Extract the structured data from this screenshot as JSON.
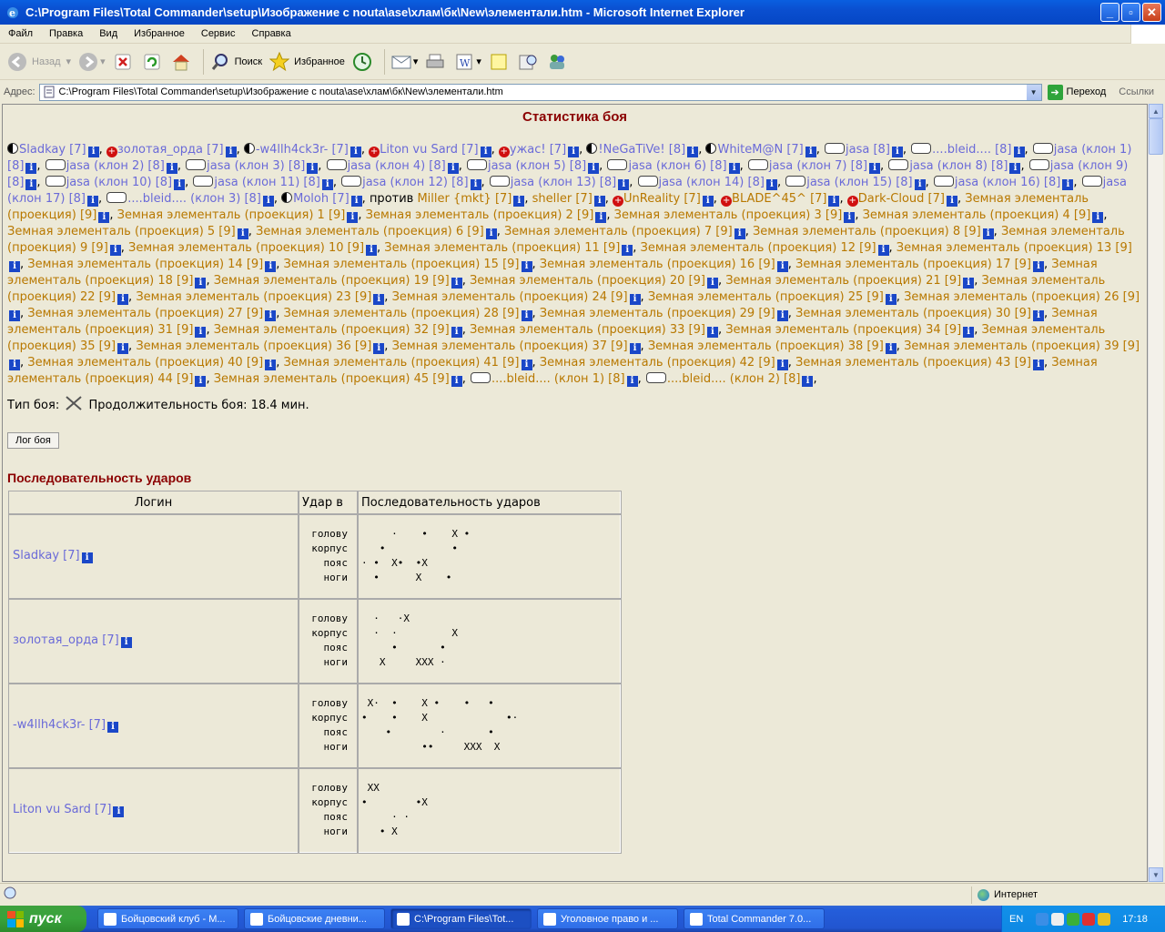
{
  "window": {
    "title": "C:\\Program Files\\Total Commander\\setup\\Изображение с nouta\\ase\\хлам\\бк\\New\\элементали.htm - Microsoft Internet Explorer"
  },
  "menu": [
    "Файл",
    "Правка",
    "Вид",
    "Избранное",
    "Сервис",
    "Справка"
  ],
  "toolbar": {
    "back": "Назад",
    "search": "Поиск",
    "favorites": "Избранное"
  },
  "address": {
    "label": "Адрес:",
    "value": "C:\\Program Files\\Total Commander\\setup\\Изображение с nouta\\ase\\хлам\\бк\\New\\элементали.htm",
    "go": "Переход",
    "links": "Ссылки"
  },
  "page": {
    "heading": "Статистика боя",
    "team1": [
      "Sladkay [7]",
      "золотая_орда [7]",
      "-w4llh4ck3r- [7]",
      "Liton vu Sard [7]",
      "ужас! [7]",
      "!NeGaTiVe! [8]",
      "WhiteM@N [7]",
      "jasa [8]",
      "....bleid.... [8]",
      "jasa (клон 1) [8]",
      "jasa (клон 2) [8]",
      "jasa (клон 3) [8]",
      "jasa (клон 4) [8]",
      "jasa (клон 5) [8]",
      "jasa (клон 6) [8]",
      "jasa (клон 7) [8]",
      "jasa (клон 8) [8]",
      "jasa (клон 9) [8]",
      "jasa (клон 10) [8]",
      "jasa (клон 11) [8]",
      "jasa (клон 12) [8]",
      "jasa (клон 13) [8]",
      "jasa (клон 14) [8]",
      "jasa (клон 15) [8]",
      "jasa (клон 16) [8]",
      "jasa (клон 17) [8]",
      "....bleid.... (клон 3) [8]",
      "Moloh [7]"
    ],
    "versus": "против",
    "team2_a": [
      "Miller {mkt} [7]",
      "sheller [7]",
      "UnReality [7]",
      "BLADE^45^ [7]",
      "Dark-Cloud [7]"
    ],
    "elemental_name": "Земная элементаль (проекция)",
    "elemental_level": "[9]",
    "elemental_count": 46,
    "team2_b": [
      "....bleid.... (клон 1) [8]",
      "....bleid.... (клон 2) [8]"
    ],
    "battle_type_label": "Тип боя:",
    "duration_label": "Продолжительность боя:",
    "duration_value": "18.4 мин.",
    "log_button": "Лог боя",
    "seq_heading": "Последовательность ударов",
    "table_headers": [
      "Логин",
      "Удар в",
      "Последовательность ударов"
    ],
    "zones": [
      "голову",
      "корпус",
      "пояс",
      "ноги"
    ],
    "rows": [
      {
        "login": "Sladkay [7]",
        "hits": [
          "     ·    •    X •",
          "   •           •",
          "· •  X•  •X",
          "  •      X    •"
        ]
      },
      {
        "login": "золотая_орда [7]",
        "hits": [
          "  ·   ·X",
          "  ·  ·         X",
          "     •       •",
          "   X     XXX ·"
        ]
      },
      {
        "login": "-w4llh4ck3r- [7]",
        "hits": [
          " X·  •    X •    •   •",
          "•    •    X             •·",
          "    •        ·       •",
          "          ••     XXX  X"
        ]
      },
      {
        "login": "Liton vu Sard [7]",
        "hits": [
          " XX",
          "•        •X",
          "     · ·",
          "   • X"
        ]
      }
    ]
  },
  "status": {
    "zone": "Интернет"
  },
  "taskbar": {
    "start": "пуск",
    "tasks": [
      "Бойцовский клуб - M...",
      "Бойцовские дневни...",
      "C:\\Program Files\\Tot...",
      "Уголовное право и ...",
      "Total Commander 7.0..."
    ],
    "lang": "EN",
    "time": "17:18"
  }
}
